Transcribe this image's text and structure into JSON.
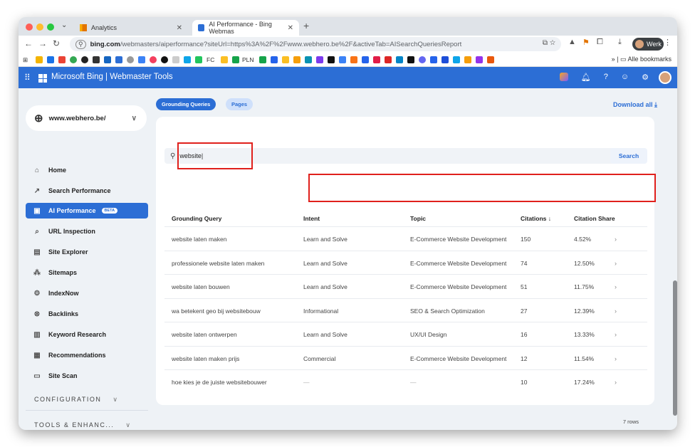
{
  "browser": {
    "tabs": [
      {
        "label": "Analytics",
        "active": false
      },
      {
        "label": "AI Performance - Bing Webmas",
        "active": true
      }
    ],
    "url_host": "bing.com",
    "url_path": "/webmasters/aiperformance?siteUrl=https%3A%2F%2Fwww.webhero.be%2F&activeTab=AISearchQueriesReport",
    "profile_label": "Werk",
    "bookmark_pln": "PLN",
    "bookmark_fc": "FC",
    "bookmarks_all": "Alle bookmarks"
  },
  "header": {
    "brand": "Microsoft Bing | Webmaster Tools"
  },
  "sidebar": {
    "site": "www.webhero.be/",
    "items": [
      {
        "label": "Home",
        "icon": "home-icon",
        "glyph": "⌂",
        "active": false
      },
      {
        "label": "Search Performance",
        "icon": "trend-icon",
        "glyph": "↗",
        "active": false
      },
      {
        "label": "AI Performance",
        "icon": "ai-icon",
        "glyph": "▣",
        "active": true,
        "badge": "BETA"
      },
      {
        "label": "URL Inspection",
        "icon": "search-icon",
        "glyph": "⌕",
        "active": false
      },
      {
        "label": "Site Explorer",
        "icon": "explorer-icon",
        "glyph": "▤",
        "active": false
      },
      {
        "label": "Sitemaps",
        "icon": "sitemap-icon",
        "glyph": "⁂",
        "active": false
      },
      {
        "label": "IndexNow",
        "icon": "indexnow-icon",
        "glyph": "⚙",
        "active": false
      },
      {
        "label": "Backlinks",
        "icon": "link-icon",
        "glyph": "⊗",
        "active": false
      },
      {
        "label": "Keyword Research",
        "icon": "keyword-icon",
        "glyph": "▥",
        "active": false
      },
      {
        "label": "Recommendations",
        "icon": "recommend-icon",
        "glyph": "▦",
        "active": false
      },
      {
        "label": "Site Scan",
        "icon": "scan-icon",
        "glyph": "▭",
        "active": false
      }
    ],
    "sections": [
      "CONFIGURATION",
      "TOOLS & ENHANC..."
    ]
  },
  "main": {
    "tabs": [
      "Grounding Queries",
      "Pages"
    ],
    "download_label": "Download all",
    "search_value": "website",
    "search_button": "Search",
    "columns": [
      "Grounding Query",
      "Intent",
      "Topic",
      "Citations",
      "Citation Share"
    ],
    "sort_indicator": "↓",
    "rows": [
      {
        "query": "website laten maken",
        "intent": "Learn and Solve",
        "topic": "E-Commerce Website Development",
        "citations": "150",
        "share": "4.52%"
      },
      {
        "query": "professionele website laten maken",
        "intent": "Learn and Solve",
        "topic": "E-Commerce Website Development",
        "citations": "74",
        "share": "12.50%"
      },
      {
        "query": "website laten bouwen",
        "intent": "Learn and Solve",
        "topic": "E-Commerce Website Development",
        "citations": "51",
        "share": "11.75%"
      },
      {
        "query": "wa betekent geo bij websitebouw",
        "intent": "Informational",
        "topic": "SEO & Search Optimization",
        "citations": "27",
        "share": "12.39%"
      },
      {
        "query": "website laten ontwerpen",
        "intent": "Learn and Solve",
        "topic": "UX/UI Design",
        "citations": "16",
        "share": "13.33%"
      },
      {
        "query": "website laten maken prijs",
        "intent": "Commercial",
        "topic": "E-Commerce Website Development",
        "citations": "12",
        "share": "11.54%"
      },
      {
        "query": "hoe kies je de juiste websitebouwer",
        "intent": "—",
        "topic": "—",
        "citations": "10",
        "share": "17.24%"
      }
    ],
    "rows_count": "7 rows"
  },
  "colors": {
    "brand_blue": "#2c6ed5",
    "highlight_red": "#e0201c"
  }
}
